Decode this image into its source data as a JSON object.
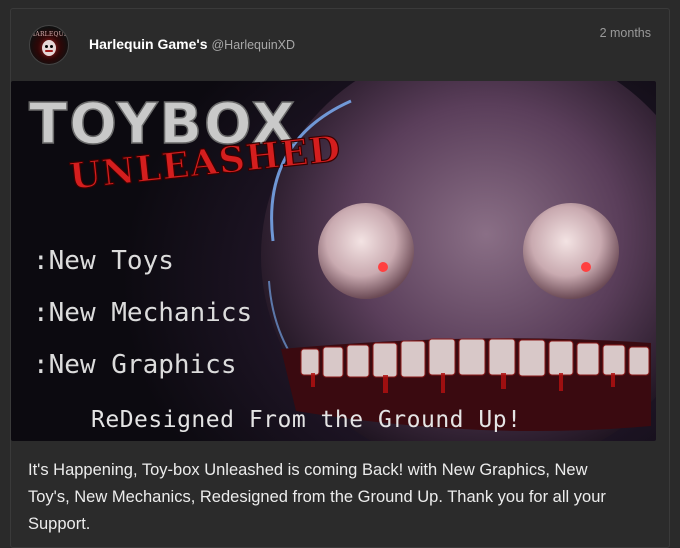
{
  "post": {
    "author": "Harlequin Game's",
    "handle": "@HarlequinXD",
    "timestamp": "2 months",
    "avatar_text": "HARLEQUIN",
    "caption": "It's Happening, Toy-box Unleashed is coming Back! with New Graphics, New Toy's, New Mechanics, Redesigned from the Ground Up. Thank you for all your Support."
  },
  "media": {
    "title_line1": "TOYBOX",
    "title_line2": "UNLEASHED",
    "features": [
      ":New Toys",
      ":New Mechanics",
      ":New Graphics"
    ],
    "tagline": "ReDesigned From the Ground Up!"
  },
  "colors": {
    "background": "#2a2a2a",
    "accent_red": "#d41e1e",
    "title_gray": "#c9c9c9"
  }
}
